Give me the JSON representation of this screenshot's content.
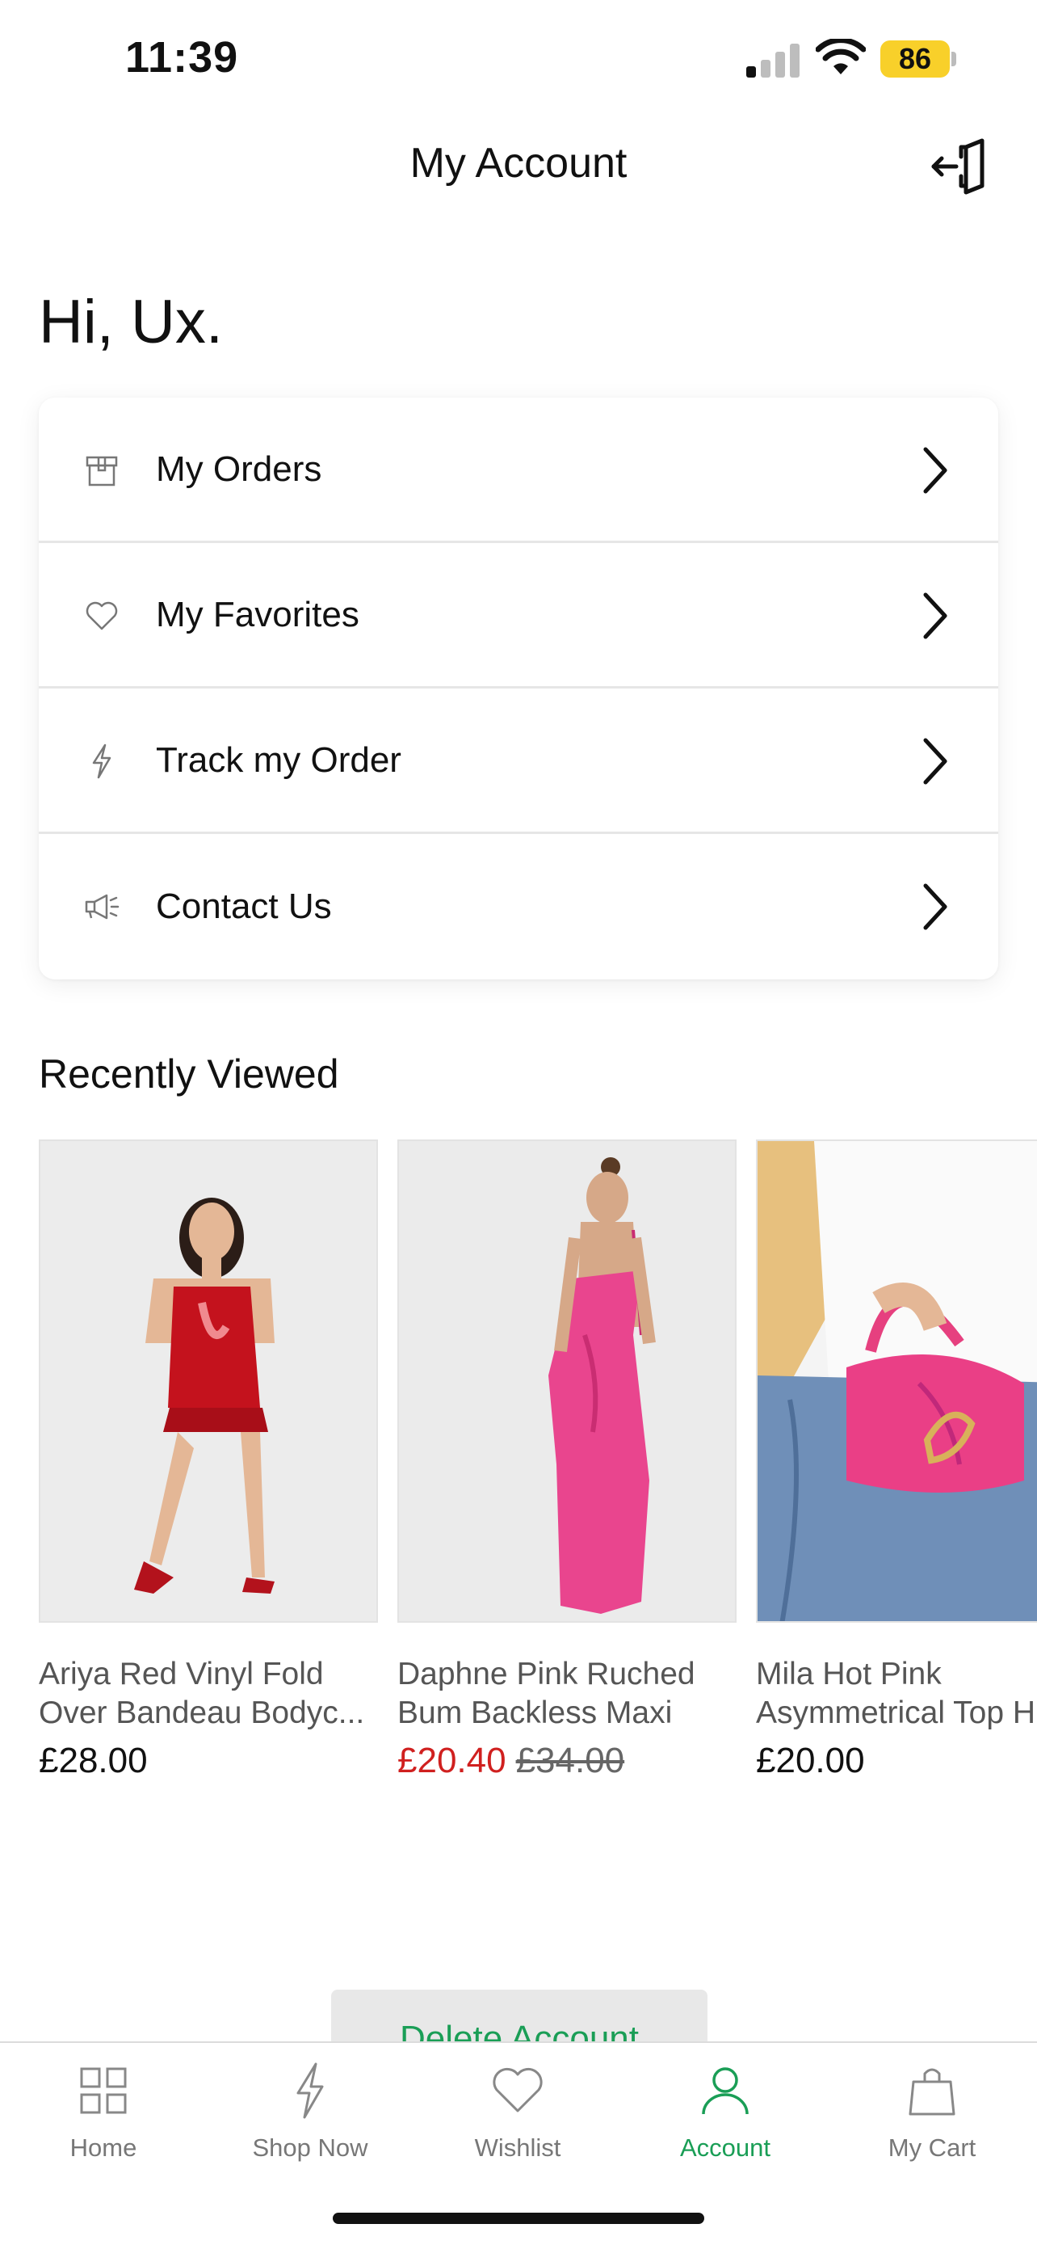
{
  "status_bar": {
    "time": "11:39",
    "battery_level": "86"
  },
  "header": {
    "title": "My Account",
    "logout_icon": "logout-icon"
  },
  "greeting": "Hi, Ux.",
  "menu": {
    "items": [
      {
        "label": "My Orders",
        "icon": "box-icon"
      },
      {
        "label": "My Favorites",
        "icon": "heart-icon"
      },
      {
        "label": "Track my Order",
        "icon": "lightning-icon"
      },
      {
        "label": "Contact Us",
        "icon": "megaphone-icon"
      }
    ]
  },
  "recently_viewed": {
    "title": "Recently Viewed",
    "products": [
      {
        "name_line1": "Ariya Red Vinyl Fold",
        "name_line2": "Over Bandeau Bodyc...",
        "price": "£28.00"
      },
      {
        "name_line1": "Daphne Pink Ruched",
        "name_line2": "Bum Backless Maxi",
        "sale_price": "£20.40",
        "original_price": "£34.00"
      },
      {
        "name_line1": "Mila Hot Pink",
        "name_line2": "Asymmetrical Top H",
        "price": "£20.00"
      }
    ]
  },
  "delete_account_label": "Delete Account",
  "tabs": [
    {
      "label": "Home",
      "icon": "grid-icon"
    },
    {
      "label": "Shop Now",
      "icon": "lightning-icon"
    },
    {
      "label": "Wishlist",
      "icon": "heart-icon"
    },
    {
      "label": "Account",
      "icon": "user-icon",
      "active": true
    },
    {
      "label": "My Cart",
      "icon": "bag-icon"
    }
  ],
  "colors": {
    "accent": "#1a9e56",
    "sale": "#d0201f",
    "battery": "#f8d02a"
  }
}
